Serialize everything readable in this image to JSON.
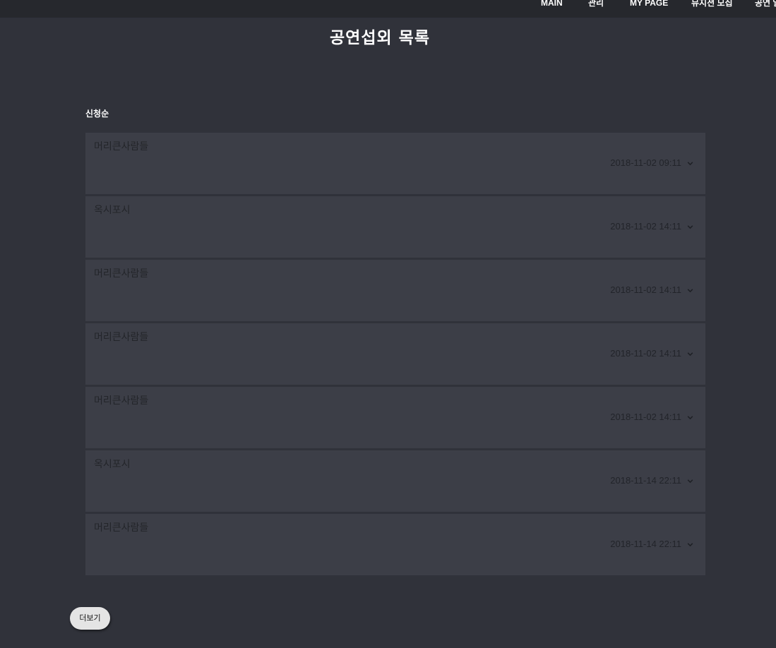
{
  "nav": {
    "items": [
      {
        "label": "MAIN"
      },
      {
        "label": "관리"
      },
      {
        "label": "MY PAGE"
      },
      {
        "label": "뮤지션 모집"
      },
      {
        "label": "공연 일"
      }
    ]
  },
  "page": {
    "title": "공연섭외 목록",
    "sort_label": "신청순"
  },
  "requests": [
    {
      "title": "머리큰사람들",
      "date": "2018-11-02 09:11",
      "expand_icon": "chevron-down-icon"
    },
    {
      "title": "옥시포시",
      "date": "2018-11-02 14:11",
      "expand_icon": "chevron-down-icon"
    },
    {
      "title": "머리큰사람들",
      "date": "2018-11-02 14:11",
      "expand_icon": "chevron-down-icon"
    },
    {
      "title": "머리큰사람들",
      "date": "2018-11-02 14:11",
      "expand_icon": "chevron-down-icon"
    },
    {
      "title": "머리큰사람들",
      "date": "2018-11-02 14:11",
      "expand_icon": "chevron-down-icon"
    },
    {
      "title": "옥시포시",
      "date": "2018-11-14 22:11",
      "expand_icon": "chevron-down-icon"
    },
    {
      "title": "머리큰사람들",
      "date": "2018-11-14 22:11",
      "expand_icon": "chevron-down-icon"
    }
  ],
  "more_button": {
    "label": "더보기"
  },
  "colors": {
    "background": "#30323a",
    "topbar": "#26282d",
    "card": "#3c3e47",
    "card_text": "#23252a",
    "button": "#e4e4e4"
  }
}
